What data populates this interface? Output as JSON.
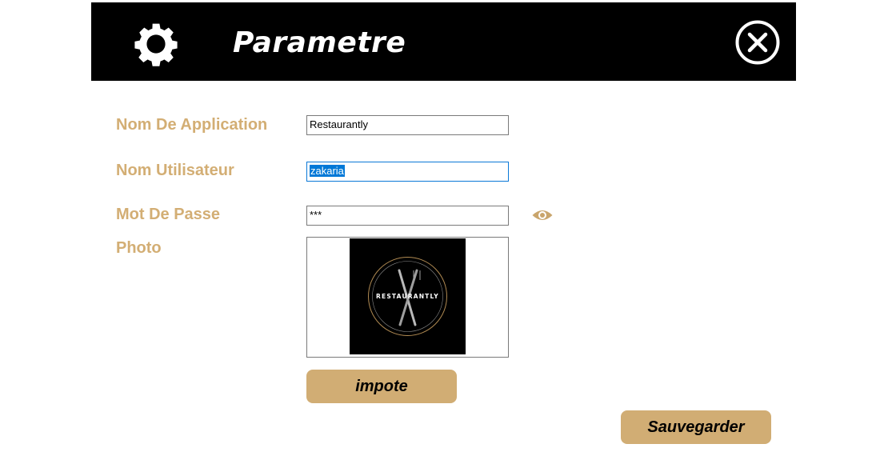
{
  "header": {
    "title": "Parametre",
    "icon_left": "gear-icon",
    "icon_right": "close-icon"
  },
  "form": {
    "app_name_label": "Nom De Application",
    "app_name_value": "Restaurantly",
    "username_label": "Nom Utilisateur",
    "username_value": "zakaria",
    "password_label": "Mot De Passe",
    "password_value": "***",
    "password_toggle_icon": "eye-icon",
    "photo_label": "Photo",
    "photo_logo_text": "RESTAURANTLY"
  },
  "buttons": {
    "import_label": "impote",
    "save_label": "Sauvegarder"
  },
  "colors": {
    "header_bg": "#000000",
    "accent": "#d3ae74",
    "button_bg": "#d1ad74",
    "selection": "#0078d7"
  }
}
